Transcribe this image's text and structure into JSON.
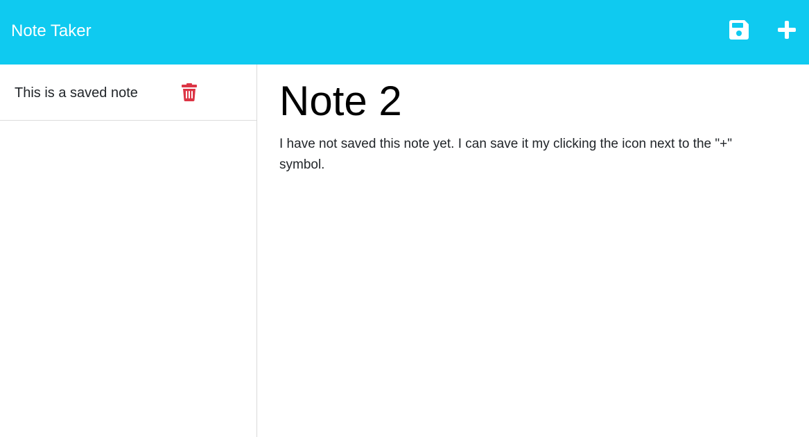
{
  "app": {
    "title": "Note Taker"
  },
  "toolbar": {
    "save_icon": "floppy-disk-icon",
    "new_icon": "plus-icon",
    "icon_color": "#ffffff",
    "bar_color": "#0fcaf0"
  },
  "sidebar": {
    "notes": [
      {
        "title": "This is a saved note",
        "delete_icon": "trash-icon",
        "delete_color": "#dc3545"
      }
    ]
  },
  "main": {
    "note_title": "Note 2",
    "note_text": "I have not saved this note yet. I can save it my clicking the icon next to the \"+\" symbol."
  }
}
